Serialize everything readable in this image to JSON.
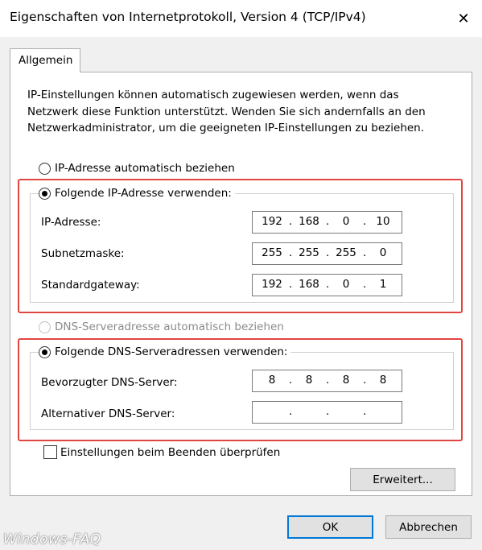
{
  "window": {
    "title": "Eigenschaften von Internetprotokoll, Version 4 (TCP/IPv4)",
    "close_glyph": "✕"
  },
  "tabs": [
    {
      "label": "Allgemein",
      "active": true
    }
  ],
  "description": [
    "IP-Einstellungen können automatisch zugewiesen werden, wenn das",
    "Netzwerk diese Funktion unterstützt. Wenden Sie sich andernfalls an den",
    "Netzwerkadministrator, um die geeigneten IP-Einstellungen zu beziehen."
  ],
  "ip_mode": {
    "auto_label": "IP-Adresse automatisch beziehen",
    "manual_label": "Folgende IP-Adresse verwenden:",
    "selected": "manual"
  },
  "ip_fields": {
    "ip_address": {
      "label": "IP-Adresse:",
      "octets": [
        "192",
        "168",
        "0",
        "10"
      ]
    },
    "subnet_mask": {
      "label": "Subnetzmaske:",
      "octets": [
        "255",
        "255",
        "255",
        "0"
      ]
    },
    "default_gateway": {
      "label": "Standardgateway:",
      "octets": [
        "192",
        "168",
        "0",
        "1"
      ]
    }
  },
  "dns_mode": {
    "auto_label": "DNS-Serveradresse automatisch beziehen",
    "manual_label": "Folgende DNS-Serveradressen verwenden:",
    "selected": "manual",
    "auto_disabled": true
  },
  "dns_fields": {
    "preferred": {
      "label": "Bevorzugter DNS-Server:",
      "octets": [
        "8",
        "8",
        "8",
        "8"
      ]
    },
    "alternate": {
      "label": "Alternativer DNS-Server:",
      "octets": [
        "",
        "",
        "",
        ""
      ]
    }
  },
  "validate_checkbox": {
    "label": "Einstellungen beim Beenden überprüfen",
    "checked": false
  },
  "buttons": {
    "advanced": "Erweitert...",
    "ok": "OK",
    "cancel": "Abbrechen"
  },
  "watermark": "Windows-FAQ",
  "colors": {
    "highlight": "#e0463f",
    "default_button_border": "#0078d7"
  }
}
